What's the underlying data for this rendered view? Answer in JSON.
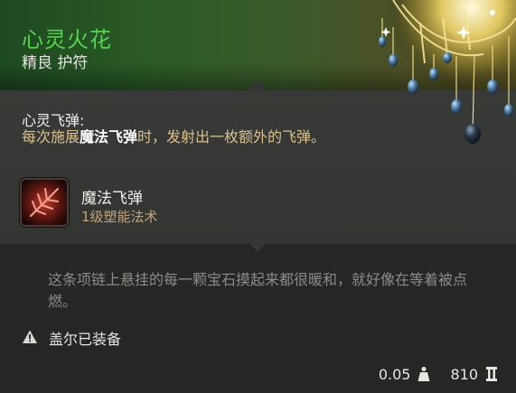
{
  "item": {
    "name": "心灵火花",
    "rarity_type": "精良 护符",
    "name_color": "#55d24e"
  },
  "ability": {
    "title": "心灵飞弹:",
    "desc_part1": "每次施展",
    "desc_highlight": "魔法飞弹",
    "desc_part2": "时，发射出一枚额外的飞弹。",
    "desc_color": "#d9c08d"
  },
  "spell": {
    "name": "魔法飞弹",
    "level": "1级塑能法术",
    "icon": "magic-missile-icon"
  },
  "flavor_text": "这条项链上悬挂的每一颗宝石摸起来都很暖和，就好像在等着被点燃。",
  "equipped": {
    "label": "盖尔已装备",
    "icon": "warning-triangle-icon"
  },
  "footer": {
    "weight": "0.05",
    "weight_icon": "weight-icon",
    "value": "810",
    "value_icon": "gold-coin-icon"
  }
}
